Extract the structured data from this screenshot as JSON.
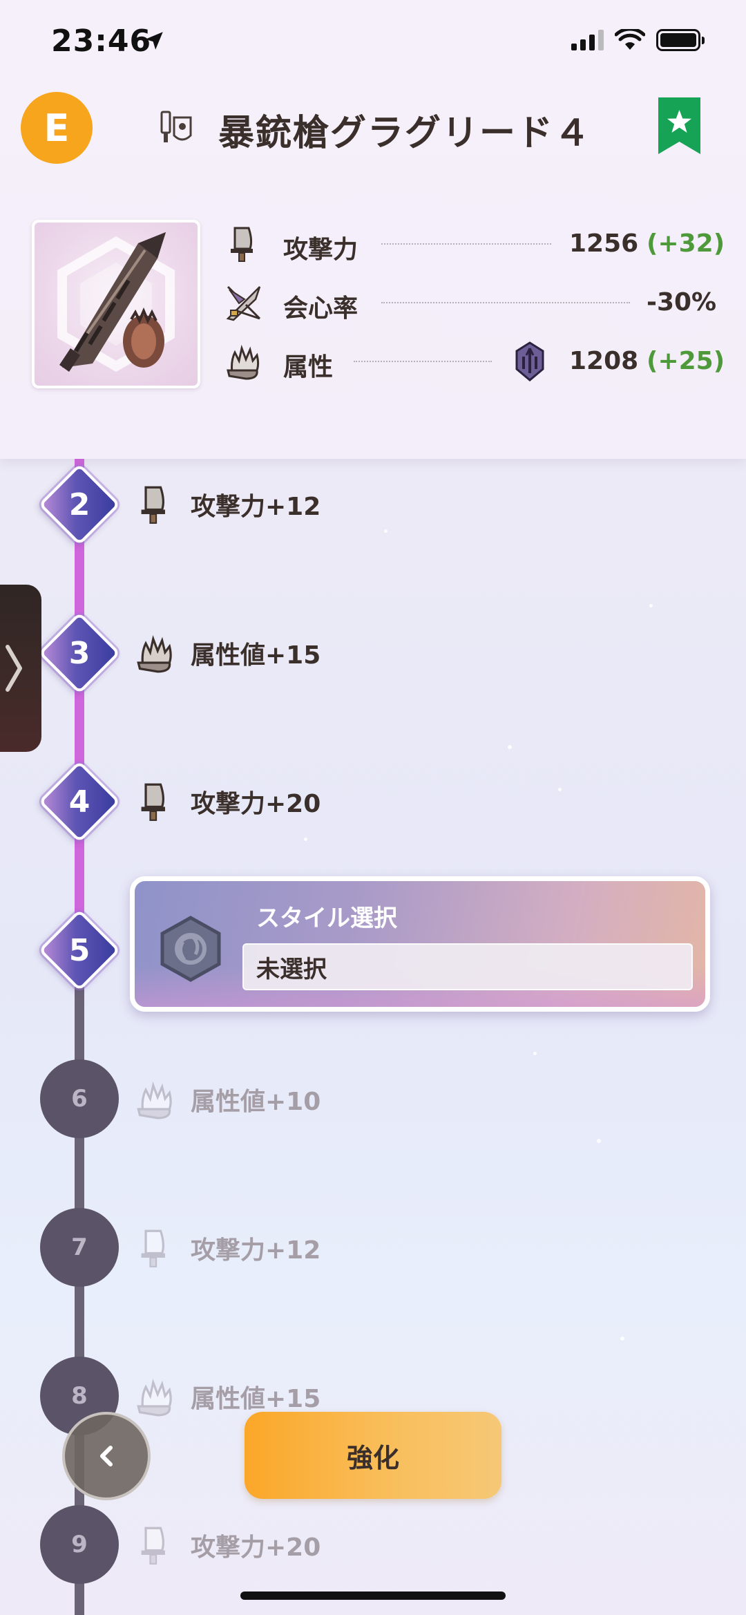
{
  "status_bar": {
    "time": "23:46"
  },
  "header": {
    "rank_badge": "E",
    "title": "暴銃槍グラグリード４",
    "favorite_icon": "star-ribbon-icon"
  },
  "stats": {
    "attack": {
      "label": "攻撃力",
      "value": "1256",
      "bonus": "(+32)"
    },
    "affinity": {
      "label": "会心率",
      "value": "-30%"
    },
    "element": {
      "label": "属性",
      "value": "1208",
      "bonus": "(+25)"
    }
  },
  "timeline": {
    "unlocked": [
      {
        "level": "2",
        "reward": "攻撃力+12",
        "icon": "attack-blade-icon"
      },
      {
        "level": "3",
        "reward": "属性値+15",
        "icon": "element-flame-icon"
      },
      {
        "level": "4",
        "reward": "攻撃力+20",
        "icon": "attack-blade-icon"
      },
      {
        "level": "5"
      }
    ],
    "locked": [
      {
        "level": "6",
        "reward": "属性値+10",
        "icon": "element-flame-icon"
      },
      {
        "level": "7",
        "reward": "攻撃力+12",
        "icon": "attack-blade-icon"
      },
      {
        "level": "8",
        "reward": "属性値+15",
        "icon": "element-flame-icon"
      },
      {
        "level": "9",
        "reward": "攻撃力+20",
        "icon": "attack-blade-icon"
      }
    ]
  },
  "style_select": {
    "title": "スタイル選択",
    "value": "未選択"
  },
  "buttons": {
    "enhance": "強化"
  },
  "colors": {
    "rank_badge": "#f6a51c",
    "bonus_green": "#4e9a3b",
    "favorite_green": "#17a355",
    "timeline_active": "#cf66db",
    "timeline_locked": "#6a6376",
    "enhance_button": "#fba729"
  }
}
